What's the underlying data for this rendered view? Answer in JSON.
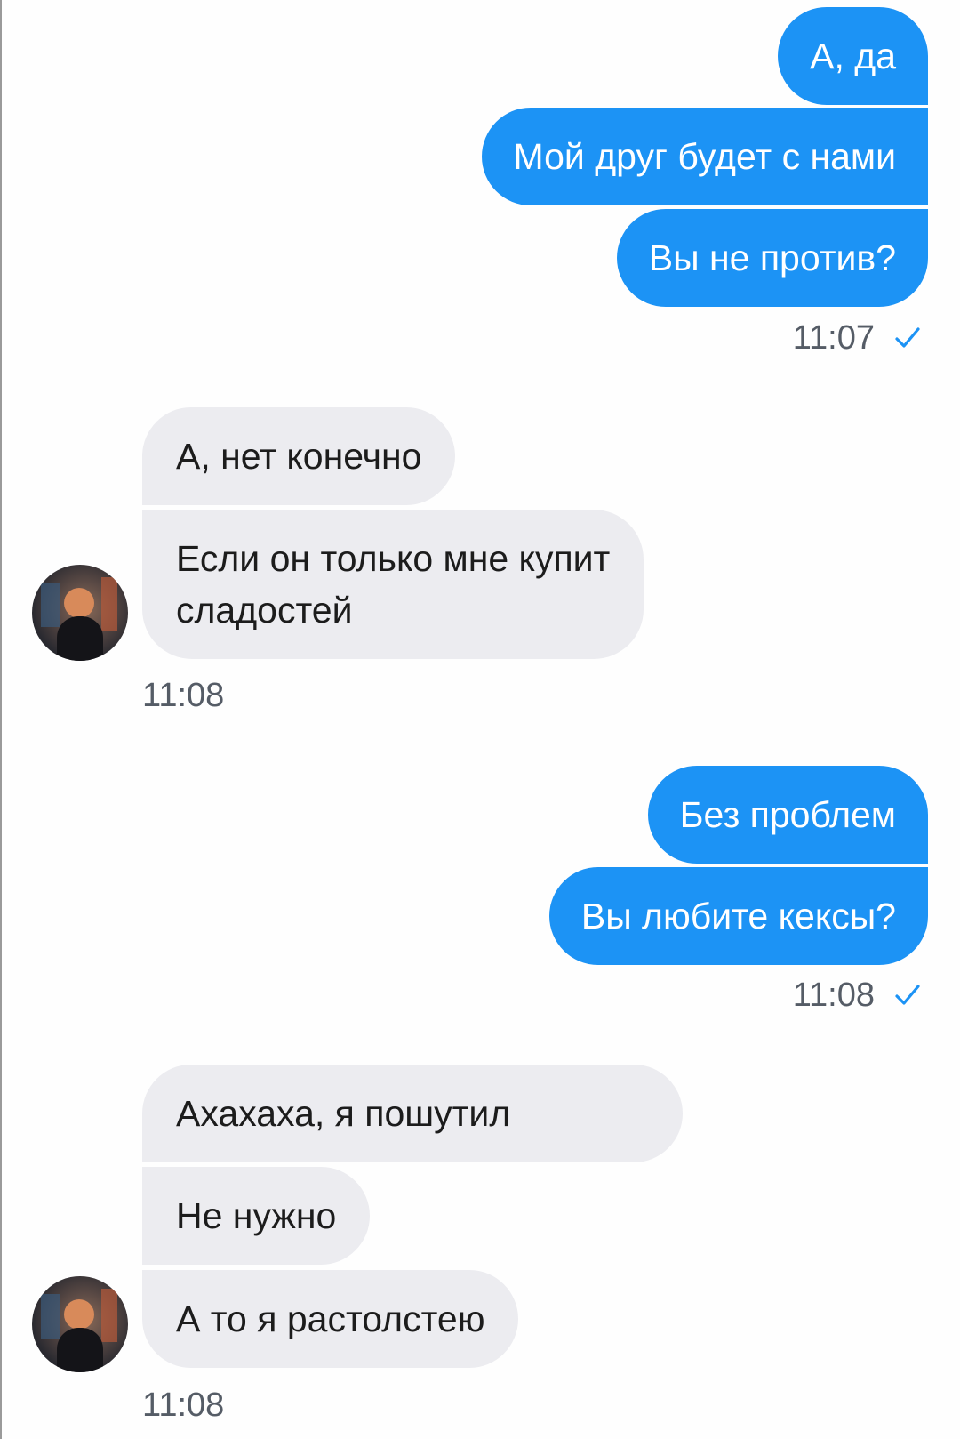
{
  "messages": {
    "out1": {
      "text": "А, да"
    },
    "out2": {
      "text": "Мой друг будет с нами"
    },
    "out3": {
      "text": "Вы не против?"
    },
    "time1": "11:07",
    "in1": {
      "text": "А, нет конечно"
    },
    "in2": {
      "line1": "Если он только мне купит",
      "line2": "сладостей"
    },
    "time2": "11:08",
    "out4": {
      "text": "Без проблем"
    },
    "out5": {
      "text": "Вы любите кексы?"
    },
    "time3": "11:08",
    "in3": {
      "text": "Ахахаха, я пошутил"
    },
    "in4": {
      "text": "Не нужно"
    },
    "in5": {
      "text": "А то я растолстею"
    },
    "time4": "11:08"
  },
  "colors": {
    "outgoing_bubble": "#1c93f5",
    "incoming_bubble": "#ececf0",
    "read_check": "#1c93f5"
  },
  "icons": {
    "read_receipt": "check-icon",
    "avatar": "contact-avatar"
  }
}
